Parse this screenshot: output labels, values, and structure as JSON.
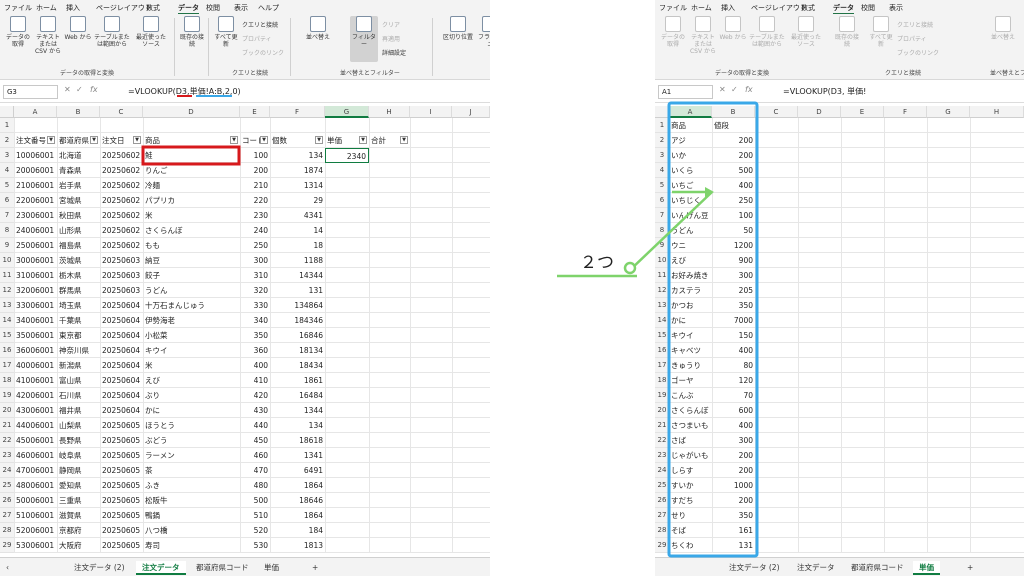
{
  "menu": [
    "ファイル",
    "ホーム",
    "挿入",
    "ページレイアウト",
    "数式",
    "データ",
    "校閲",
    "表示",
    "ヘルプ"
  ],
  "menu_right": [
    "ファイル",
    "ホーム",
    "挿入",
    "ページレイアウト",
    "数式",
    "データ",
    "校閲",
    "表示"
  ],
  "ribbon": {
    "get_data": "データの取得",
    "text_csv": "テキストまたは CSV から",
    "web": "Web から",
    "table_range": "テーブルまたは範囲から",
    "recent": "最近使ったソース",
    "existing": "既存の接続",
    "refresh_all": "すべて更新",
    "queries": "クエリと接続",
    "properties": "プロパティ",
    "workbook_links": "ブックのリンク",
    "sort": "並べ替え",
    "filter": "フィルター",
    "clear": "クリア",
    "reapply": "再適用",
    "advanced": "詳細設定",
    "text_to_columns": "区切り位置",
    "flash": "フラッシュ",
    "group_get": "データの取得と変換",
    "group_query": "クエリと接続",
    "group_sort": "並べ替えとフィルター"
  },
  "left": {
    "namebox": "G3",
    "formula": "=VLOOKUP(D3,単価!A:B,2,0)",
    "columns": [
      "A",
      "B",
      "C",
      "D",
      "E",
      "F",
      "G",
      "H",
      "I",
      "J"
    ],
    "headers": [
      "注文番号",
      "都道府県",
      "注文日",
      "商品",
      "コード",
      "個数",
      "単価",
      "合計"
    ],
    "rows": [
      [
        "10006001",
        "北海道",
        "20250602",
        "鮭",
        "100",
        "134",
        "2340"
      ],
      [
        "20006001",
        "青森県",
        "20250602",
        "りんご",
        "200",
        "1874",
        ""
      ],
      [
        "21006001",
        "岩手県",
        "20250602",
        "冷麺",
        "210",
        "1314",
        ""
      ],
      [
        "22006001",
        "宮城県",
        "20250602",
        "パプリカ",
        "220",
        "29",
        ""
      ],
      [
        "23006001",
        "秋田県",
        "20250602",
        "米",
        "230",
        "4341",
        ""
      ],
      [
        "24006001",
        "山形県",
        "20250602",
        "さくらんぼ",
        "240",
        "14",
        ""
      ],
      [
        "25006001",
        "福島県",
        "20250602",
        "もも",
        "250",
        "18",
        ""
      ],
      [
        "30006001",
        "茨城県",
        "20250603",
        "納豆",
        "300",
        "1188",
        ""
      ],
      [
        "31006001",
        "栃木県",
        "20250603",
        "餃子",
        "310",
        "14344",
        ""
      ],
      [
        "32006001",
        "群馬県",
        "20250603",
        "うどん",
        "320",
        "131",
        ""
      ],
      [
        "33006001",
        "埼玉県",
        "20250604",
        "十万石まんじゅう",
        "330",
        "134864",
        ""
      ],
      [
        "34006001",
        "千葉県",
        "20250604",
        "伊勢海老",
        "340",
        "184346",
        ""
      ],
      [
        "35006001",
        "東京都",
        "20250604",
        "小松菜",
        "350",
        "16846",
        ""
      ],
      [
        "36006001",
        "神奈川県",
        "20250604",
        "キウイ",
        "360",
        "18134",
        ""
      ],
      [
        "40006001",
        "新潟県",
        "20250604",
        "米",
        "400",
        "18434",
        ""
      ],
      [
        "41006001",
        "富山県",
        "20250604",
        "えび",
        "410",
        "1861",
        ""
      ],
      [
        "42006001",
        "石川県",
        "20250604",
        "ぶり",
        "420",
        "16484",
        ""
      ],
      [
        "43006001",
        "福井県",
        "20250604",
        "かに",
        "430",
        "1344",
        ""
      ],
      [
        "44006001",
        "山梨県",
        "20250605",
        "ほうとう",
        "440",
        "134",
        ""
      ],
      [
        "45006001",
        "長野県",
        "20250605",
        "ぶどう",
        "450",
        "18618",
        ""
      ],
      [
        "46006001",
        "岐阜県",
        "20250605",
        "ラーメン",
        "460",
        "1341",
        ""
      ],
      [
        "47006001",
        "静岡県",
        "20250605",
        "茶",
        "470",
        "6491",
        ""
      ],
      [
        "48006001",
        "愛知県",
        "20250605",
        "ふき",
        "480",
        "1864",
        ""
      ],
      [
        "50006001",
        "三重県",
        "20250605",
        "松阪牛",
        "500",
        "18646",
        ""
      ],
      [
        "51006001",
        "滋賀県",
        "20250605",
        "鴨鍋",
        "510",
        "1864",
        ""
      ],
      [
        "52006001",
        "京都府",
        "20250605",
        "八つ橋",
        "520",
        "184",
        ""
      ],
      [
        "53006001",
        "大阪府",
        "20250605",
        "寿司",
        "530",
        "1813",
        ""
      ]
    ],
    "tabs": [
      "注文データ (2)",
      "注文データ",
      "都道府県コード",
      "単価"
    ],
    "active_tab": "注文データ"
  },
  "right": {
    "namebox": "A1",
    "formula": "=VLOOKUP(D3, 単価!",
    "columns": [
      "A",
      "B",
      "C",
      "D",
      "E",
      "F",
      "G",
      "H"
    ],
    "headers": [
      "商品",
      "値段"
    ],
    "rows": [
      [
        "アジ",
        "200"
      ],
      [
        "いか",
        "200"
      ],
      [
        "いくら",
        "500"
      ],
      [
        "いちご",
        "400"
      ],
      [
        "いちじく",
        "250"
      ],
      [
        "いんげん豆",
        "100"
      ],
      [
        "うどん",
        "50"
      ],
      [
        "ウニ",
        "1200"
      ],
      [
        "えび",
        "900"
      ],
      [
        "お好み焼き",
        "300"
      ],
      [
        "カステラ",
        "205"
      ],
      [
        "かつお",
        "350"
      ],
      [
        "かに",
        "7000"
      ],
      [
        "キウイ",
        "150"
      ],
      [
        "キャベツ",
        "400"
      ],
      [
        "きゅうり",
        "80"
      ],
      [
        "ゴーヤ",
        "120"
      ],
      [
        "こんぶ",
        "70"
      ],
      [
        "さくらんぼ",
        "600"
      ],
      [
        "さつまいも",
        "400"
      ],
      [
        "さば",
        "300"
      ],
      [
        "じゃがいも",
        "200"
      ],
      [
        "しらす",
        "200"
      ],
      [
        "すいか",
        "1000"
      ],
      [
        "すだち",
        "200"
      ],
      [
        "せり",
        "350"
      ],
      [
        "そば",
        "161"
      ],
      [
        "ちくわ",
        "131"
      ]
    ],
    "tabs": [
      "注文データ (2)",
      "注文データ",
      "都道府県コード",
      "単価"
    ],
    "active_tab": "単価"
  },
  "annotation": {
    "label": "２つ",
    "color": "#7ed36b",
    "highlight_color": "#d7191c",
    "range_color": "#3aa8e8"
  }
}
